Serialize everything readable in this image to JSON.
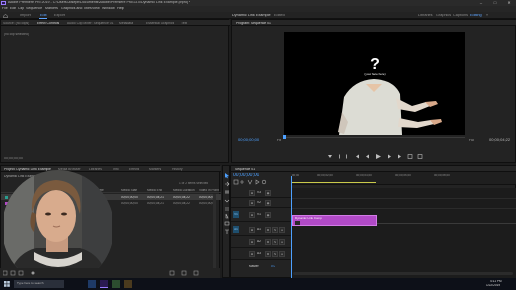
{
  "window": {
    "title": "Adobe Premiere Pro 2019 - C:\\Users\\Joseph\\Documents\\Adobe\\Premiere Pro\\13.0\\Dynamic Link Example.prproj *",
    "min_label": "–",
    "max_label": "□",
    "close_label": "✕"
  },
  "menu": [
    "File",
    "Edit",
    "Clip",
    "Sequence",
    "Markers",
    "Graphics and Titles",
    "View",
    "Window",
    "Help"
  ],
  "workspaces": {
    "home_icon": "home-icon",
    "left": [
      "Import",
      "Edit",
      "Export"
    ],
    "active_left": "Edit",
    "center_title": "Dynamic Link Example",
    "center_sub": "Edited",
    "right": [
      "Libraries",
      "Graphics",
      "Captions",
      "Editing"
    ],
    "active_right": "Editing",
    "more": "»"
  },
  "source_panel": {
    "tabs": [
      "Source: (no clips)",
      "Effect Controls",
      "Audio Clip Mixer: Sequence 01",
      "Metadata",
      "Essential Graphics",
      "Text"
    ],
    "active_tab": "Effect Controls",
    "body_text": "(no clip selected)",
    "timecode": "00;00;00;00"
  },
  "program_panel": {
    "tab": "Program: Sequence 01",
    "overlay_question": "?",
    "overlay_label": "(your face here)",
    "timecode_left": "00;00;00;00",
    "fit": "Fit",
    "full": "Full",
    "timecode_right": "00;00;04;22"
  },
  "project_panel": {
    "tabs": [
      "Project: Dynamic Link Example",
      "Media Browser",
      "Libraries",
      "Info",
      "Effects",
      "Markers",
      "History"
    ],
    "active_tab": "Project: Dynamic Link Example",
    "file": "Dynamic Link Example.prproj",
    "items_selected": "1 of 2 items selected",
    "columns": [
      "Name",
      "Frame Rate",
      "Media Start",
      "Media End",
      "Media Duration",
      "Video In Point"
    ],
    "rows": [
      {
        "name": "Sequence 01",
        "rate": "29.97 fps",
        "start": "00;00;00;00",
        "end": "00;00;04;21",
        "duration": "00;00;04;22",
        "in": "00;00;00;00",
        "selected": true
      },
      {
        "name": "Dynamic Link Clip",
        "rate": "29.97 fps",
        "start": "00;00;00;00",
        "end": "00;00;04;21",
        "duration": "00;00;04;22",
        "in": "00;00;00;00",
        "selected": false
      }
    ]
  },
  "timeline": {
    "tab": "Sequence 01",
    "timecode": "00;00;00;00",
    "ruler_start": ":00;00",
    "ruler_marks": [
      "00;00;02;00",
      "00;00;04;00",
      "00;00;06;00",
      "00;00;08;00"
    ],
    "tracks_video": [
      "V3",
      "V2",
      "V1"
    ],
    "tracks_audio": [
      "A1",
      "A2",
      "A3"
    ],
    "master": "Master",
    "master_value": "0.0",
    "clip_label": "Dynamic Link Comp",
    "clip_color": "#b14ac7"
  },
  "taskbar": {
    "time": "4:11 PM",
    "date": "1/22/2019",
    "search": "Type here to search"
  }
}
